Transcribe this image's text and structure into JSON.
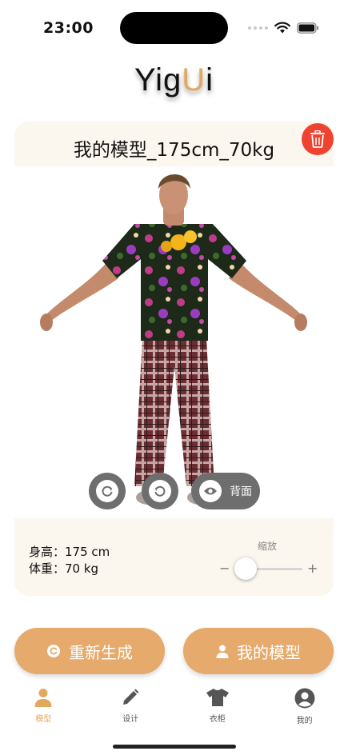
{
  "status_bar": {
    "time": "23:00"
  },
  "app": {
    "title_part1": "Yig",
    "title_accent": "U",
    "title_part2": "i"
  },
  "model": {
    "name": "我的模型_175cm_70kg",
    "height_label": "身高：",
    "height_value": "175 cm",
    "weight_label": "体重：",
    "weight_value": "70 kg",
    "back_label": "背面"
  },
  "zoom": {
    "label": "缩放",
    "minus": "−",
    "plus": "+",
    "level": 0.15
  },
  "actions": {
    "regenerate": "重新生成",
    "my_models": "我的模型"
  },
  "tabs": [
    {
      "label": "模型",
      "icon": "person-icon",
      "active": true
    },
    {
      "label": "设计",
      "icon": "pencil-icon",
      "active": false
    },
    {
      "label": "衣柜",
      "icon": "tshirt-icon",
      "active": false
    },
    {
      "label": "我的",
      "icon": "account-circle-icon",
      "active": false
    }
  ],
  "colors": {
    "accent": "#e3a85f",
    "card_bg": "#fbf6ee",
    "delete": "#f04230",
    "control": "#6e6e6e"
  }
}
